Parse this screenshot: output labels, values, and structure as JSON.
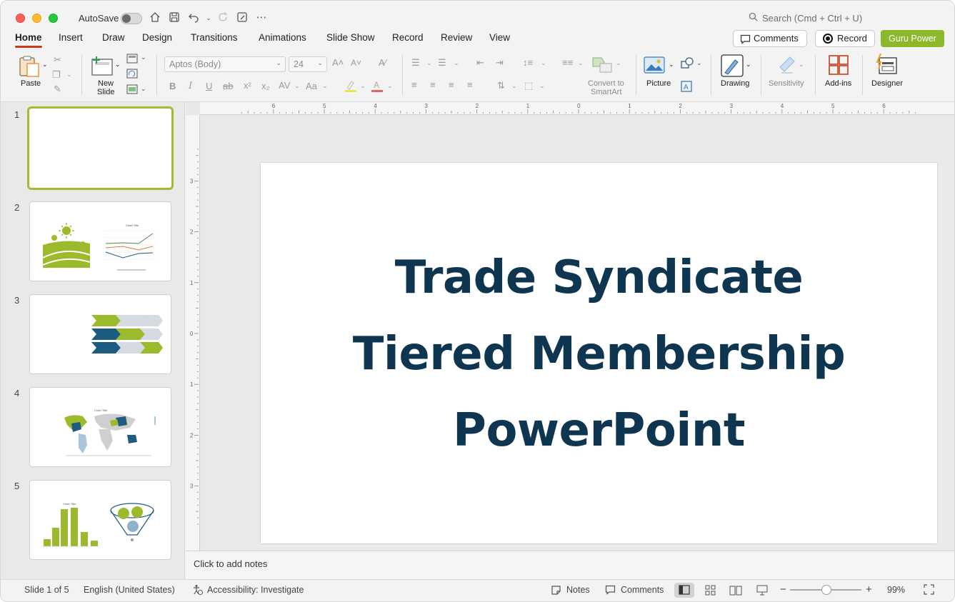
{
  "titlebar": {
    "autosave_label": "AutoSave",
    "search_placeholder": "Search (Cmd + Ctrl + U)"
  },
  "tabs": [
    {
      "label": "Home",
      "active": true
    },
    {
      "label": "Insert"
    },
    {
      "label": "Draw"
    },
    {
      "label": "Design"
    },
    {
      "label": "Transitions"
    },
    {
      "label": "Animations"
    },
    {
      "label": "Slide Show"
    },
    {
      "label": "Record"
    },
    {
      "label": "Review"
    },
    {
      "label": "View"
    }
  ],
  "actions": {
    "comments": "Comments",
    "record": "Record",
    "guru": "Guru Power"
  },
  "ribbon": {
    "paste": "Paste",
    "new_slide_1": "New",
    "new_slide_2": "Slide",
    "font_name": "Aptos (Body)",
    "font_size": "24",
    "convert_1": "Convert to",
    "convert_2": "SmartArt",
    "picture": "Picture",
    "drawing": "Drawing",
    "sensitivity": "Sensitivity",
    "addins": "Add-ins",
    "designer": "Designer"
  },
  "slides": [
    {
      "num": "1",
      "selected": true
    },
    {
      "num": "2"
    },
    {
      "num": "3"
    },
    {
      "num": "4"
    },
    {
      "num": "5"
    }
  ],
  "thumb_text": {
    "chart_title": "Chart Title"
  },
  "slide": {
    "line1": "Trade Syndicate",
    "line2": "Tiered Membership",
    "line3": "PowerPoint"
  },
  "notes_placeholder": "Click to add notes",
  "status": {
    "slide_of": "Slide 1 of 5",
    "language": "English (United States)",
    "accessibility": "Accessibility: Investigate",
    "notes": "Notes",
    "comments": "Comments",
    "zoom": "99%"
  },
  "colors": {
    "accent_tab": "#c43e1c",
    "title_text": "#0e3650",
    "guru_button": "#8cb82b",
    "thumb_green": "#9bbb2c",
    "thumb_blue": "#1e5b80"
  }
}
